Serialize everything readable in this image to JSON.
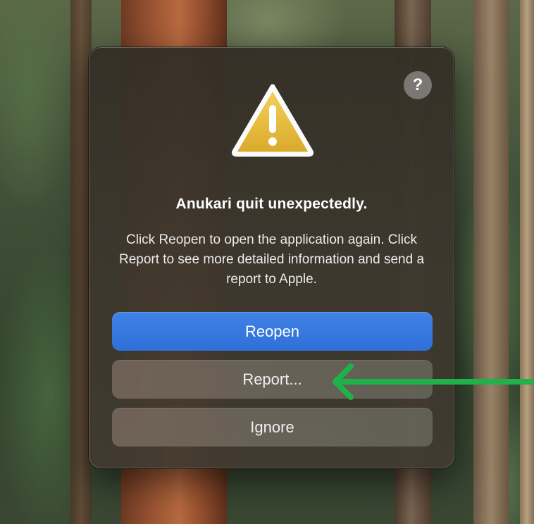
{
  "dialog": {
    "help_label": "?",
    "icon": "warning-triangle-icon",
    "title": "Anukari quit unexpectedly.",
    "message": "Click Reopen to open the application again. Click Report to see more detailed information and send a report to Apple.",
    "buttons": {
      "reopen": "Reopen",
      "report": "Report...",
      "ignore": "Ignore"
    }
  },
  "annotation": {
    "icon": "arrow-left-icon",
    "color": "#1fb24a"
  },
  "colors": {
    "primary_button": "#3478e0",
    "warning_yellow": "#e9b935"
  }
}
